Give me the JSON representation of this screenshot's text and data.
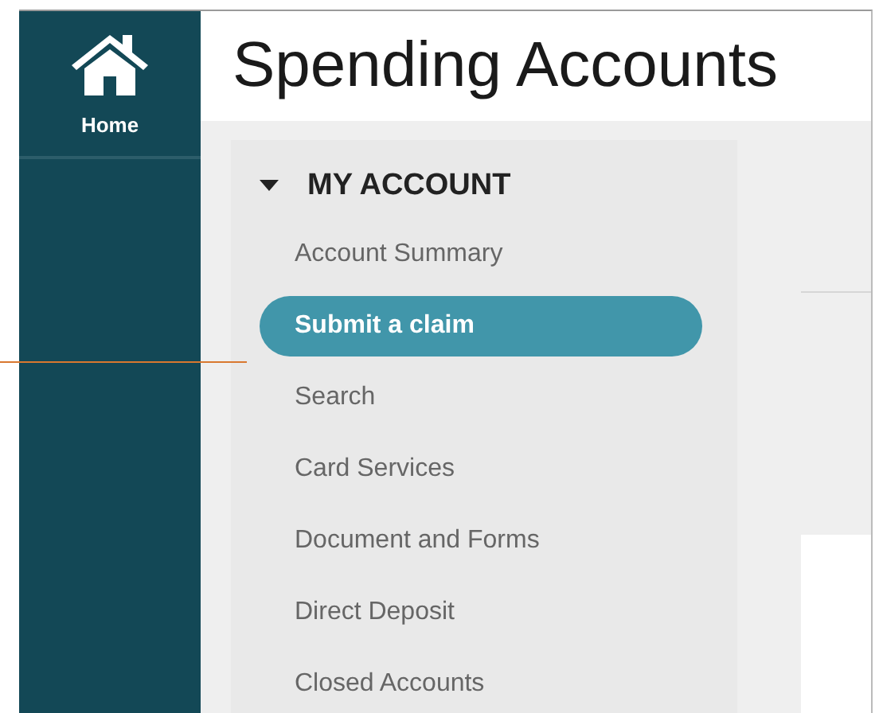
{
  "nav": {
    "home_label": "Home"
  },
  "page_title": "Spending Accounts",
  "menu": {
    "heading": "MY ACCOUNT",
    "expanded": true,
    "items": [
      {
        "label": "Account Summary",
        "selected": false
      },
      {
        "label": "Submit a claim",
        "selected": true
      },
      {
        "label": "Search",
        "selected": false
      },
      {
        "label": "Card Services",
        "selected": false
      },
      {
        "label": "Document and Forms",
        "selected": false
      },
      {
        "label": "Direct Deposit",
        "selected": false
      },
      {
        "label": "Closed Accounts",
        "selected": false
      }
    ]
  }
}
